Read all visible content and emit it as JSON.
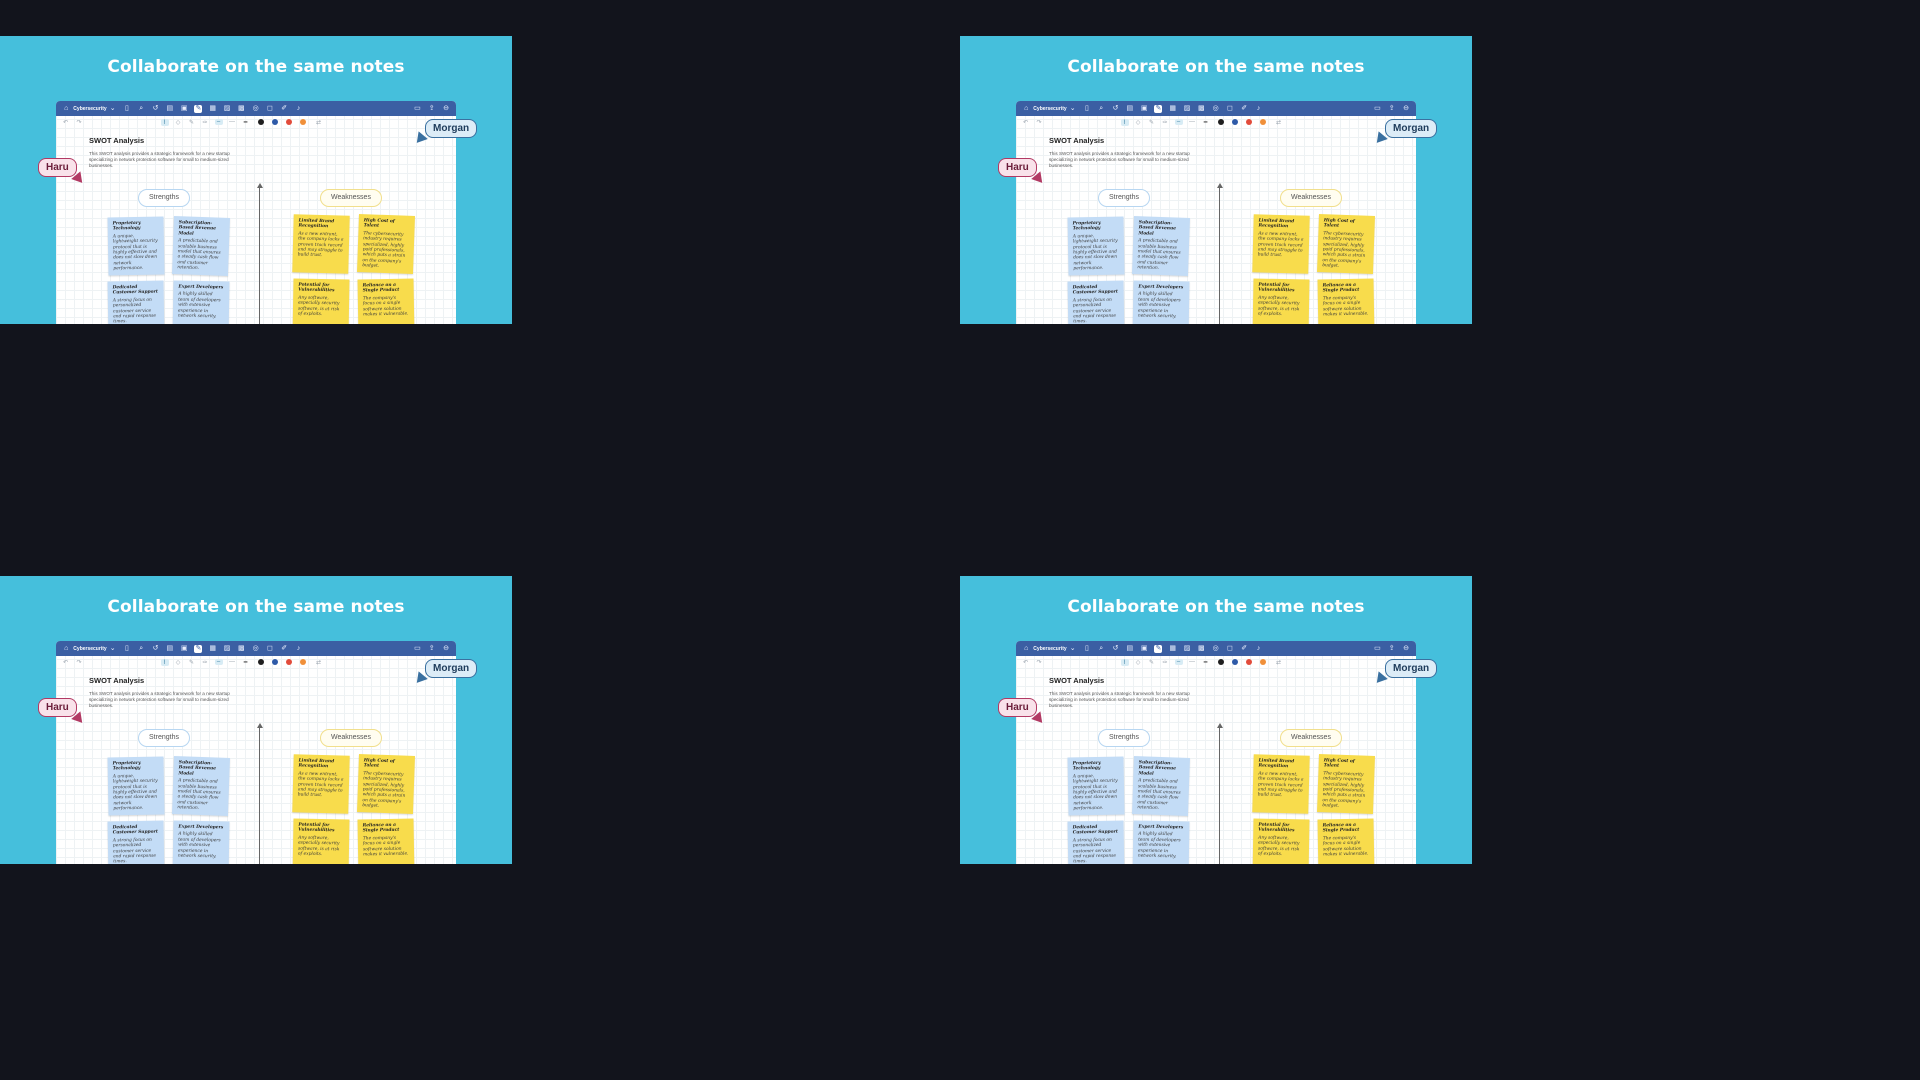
{
  "page": {
    "background": "#12141c",
    "tile_color": "#45bfdc",
    "title": "Collaborate on the same notes"
  },
  "app": {
    "document_name": "Cybersecurity",
    "topbar_icons": [
      "home-icon",
      "sidebar-icon",
      "search-icon",
      "undo-icon",
      "bookmark-icon",
      "layout-icon",
      "pen-icon",
      "table-icon",
      "image-icon",
      "sticker-icon",
      "shapes-icon",
      "comment-icon",
      "pencil-icon",
      "mic-icon",
      "doc-icon",
      "share-icon",
      "more-icon"
    ],
    "toolbar_colors": [
      "#1f1f1f",
      "#2e5aa8",
      "#e24b3b",
      "#f0903a"
    ],
    "note_title": "SWOT Analysis",
    "note_description": "This SWOT analysis provides a strategic framework for a new startup specializing in network protection software for small to medium-sized businesses.",
    "sections": {
      "strengths": "Strengths",
      "weaknesses": "Weaknesses"
    },
    "notes": [
      {
        "color": "blue",
        "title": "Proprietary Technology",
        "body": "A unique, lightweight security protocol that is highly effective and does not slow down network performance."
      },
      {
        "color": "blue",
        "title": "Subscription-Based Revenue Model",
        "body": "A predictable and scalable business model that ensures a steady cash flow and customer retention."
      },
      {
        "color": "blue",
        "title": "Dedicated Customer Support",
        "body": "A strong focus on personalized customer service and rapid response times."
      },
      {
        "color": "blue",
        "title": "Expert Developers",
        "body": "A highly skilled team of developers with extensive experience in network security."
      },
      {
        "color": "yellow",
        "title": "Limited Brand Recognition",
        "body": "As a new entrant, the company lacks a proven track record and may struggle to build trust."
      },
      {
        "color": "yellow",
        "title": "High Cost of Talent",
        "body": "The cybersecurity industry requires specialized, highly paid professionals, which puts a strain on the company's budget."
      },
      {
        "color": "yellow",
        "title": "Potential for Vulnerabilities",
        "body": "Any software, especially security software, is at risk of exploits."
      },
      {
        "color": "yellow",
        "title": "Reliance on a Single Product",
        "body": "The company's focus on a single software solution makes it vulnerable."
      }
    ],
    "collaborators": {
      "haru": "Haru",
      "morgan": "Morgan"
    }
  }
}
